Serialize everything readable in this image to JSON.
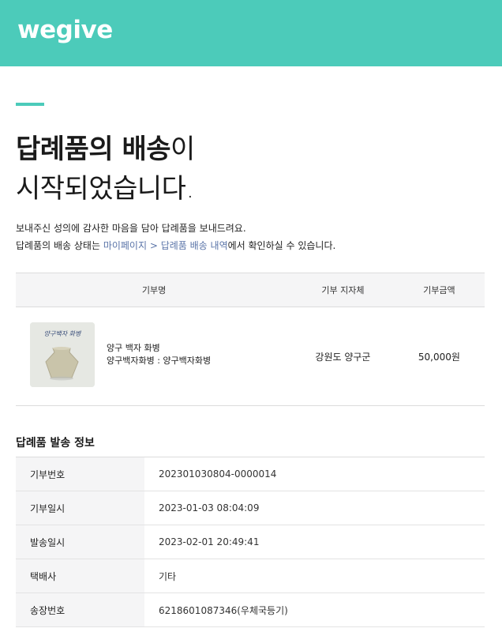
{
  "brand": {
    "logo_text": "wegive",
    "accent_color": "#4ccbba",
    "link_color": "#5a74a8"
  },
  "headline": {
    "line1_bold": "답례품의 배송",
    "line1_light": "이",
    "line2": "시작되었습니다."
  },
  "intro": {
    "line1": "보내주신 성의에 감사한 마음을 담아 답례품을 보내드려요.",
    "line2_prefix": "답례품의 배송 상태는 ",
    "line2_link": "마이페이지 > 답례품 배송 내역",
    "line2_suffix": "에서 확인하실 수 있습니다."
  },
  "donation_table": {
    "headers": {
      "name": "기부명",
      "region": "기부 지자체",
      "amount": "기부금액"
    },
    "row": {
      "thumb_label": "양구백자 화병",
      "title": "양구 백자 화병",
      "option": "양구백자화병 : 양구백자화병",
      "region": "강원도 양구군",
      "amount": "50,000원"
    }
  },
  "shipping_info": {
    "title": "답례품 발송 정보",
    "rows": [
      {
        "label": "기부번호",
        "value": "202301030804-0000014"
      },
      {
        "label": "기부일시",
        "value": "2023-01-03 08:04:09"
      },
      {
        "label": "발송일시",
        "value": "2023-02-01 20:49:41"
      },
      {
        "label": "택배사",
        "value": "기타"
      },
      {
        "label": "송장번호",
        "value": "6218601087346(우체국등기)"
      }
    ]
  }
}
